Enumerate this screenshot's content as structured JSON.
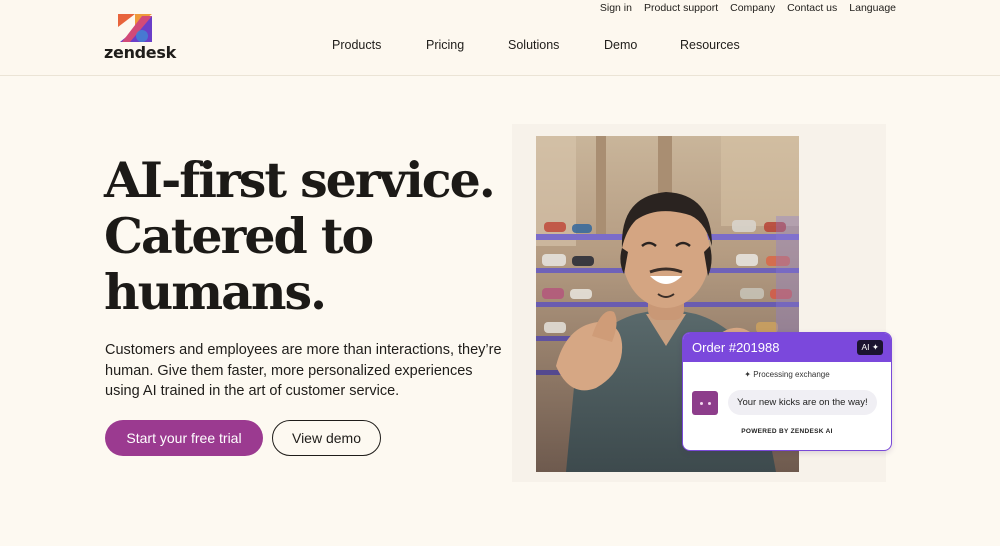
{
  "brand": {
    "name": "zendesk",
    "colors": {
      "primary_purple": "#9b3a90",
      "chat_purple": "#7b48dc",
      "background": "#fdf9f1",
      "logo_orange": "#e8643c",
      "logo_purple": "#6a3fc8"
    }
  },
  "utility_nav": [
    "Sign in",
    "Product support",
    "Company",
    "Contact us",
    "Language"
  ],
  "main_nav": [
    "Products",
    "Pricing",
    "Solutions",
    "Demo",
    "Resources"
  ],
  "hero": {
    "title_lines": [
      "AI-first service.",
      "Catered to",
      "humans."
    ],
    "subtitle": "Customers and employees are more than interactions, they’re human. Give them faster, more personalized experiences using AI trained in the art of customer service.",
    "primary_cta": "Start your free trial",
    "secondary_cta": "View demo"
  },
  "chat_card": {
    "order": "Order #201988",
    "badge": "AI ✦",
    "status_icon": "sparkle-icon",
    "status": "✦ Processing exchange",
    "message": "Your new kicks are on the way!",
    "powered_by": "POWERED BY ZENDESK AI",
    "avatar_icon": "bot-face-icon"
  },
  "image": {
    "subject": "hero-photo"
  }
}
